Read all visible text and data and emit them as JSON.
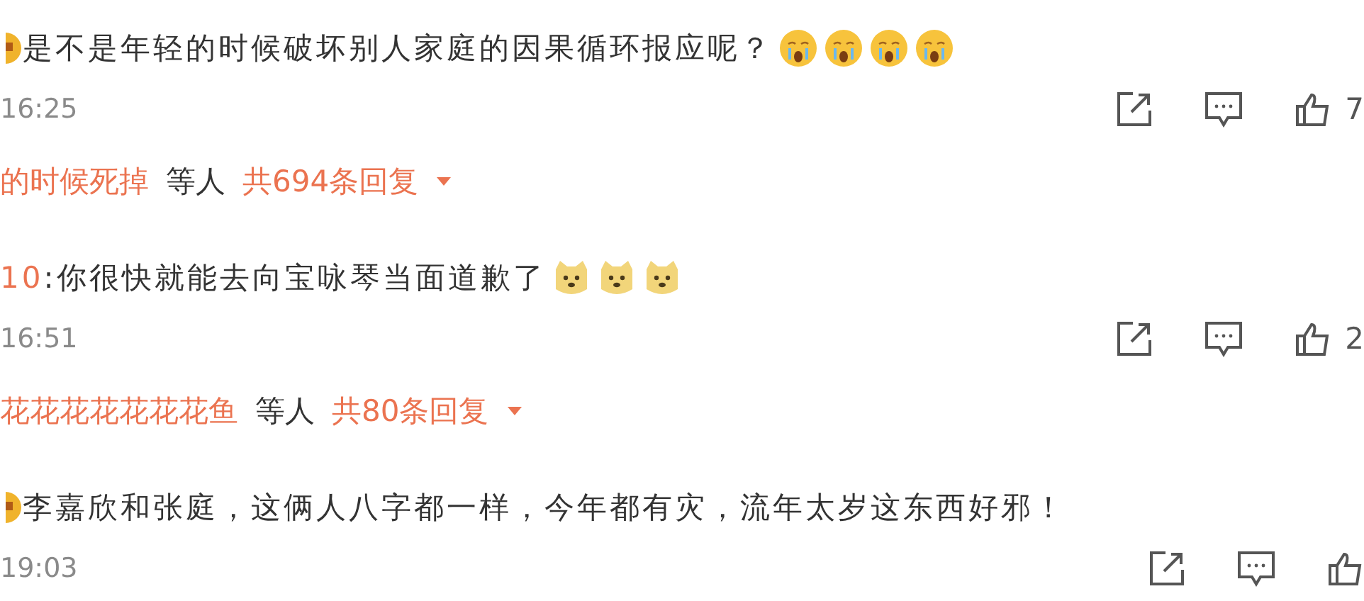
{
  "comments": [
    {
      "lead_icon": true,
      "text": "是不是年轻的时候破坏别人家庭的因果循环报应呢？",
      "emojis": [
        {
          "kind": "crying"
        },
        {
          "kind": "crying"
        },
        {
          "kind": "crying"
        },
        {
          "kind": "crying"
        }
      ],
      "time": "16:25",
      "likes": "7",
      "replies": {
        "names": "的时候死掉",
        "suffix": "等人",
        "count": "共694条回复"
      }
    },
    {
      "lead_icon": false,
      "author": "10",
      "text": ":你很快就能去向宝咏琴当面道歉了",
      "emojis": [
        {
          "kind": "doge"
        },
        {
          "kind": "doge"
        },
        {
          "kind": "doge"
        }
      ],
      "time": "16:51",
      "likes": "2",
      "replies": {
        "names": "花花花花花花花鱼",
        "suffix": "等人",
        "count": "共80条回复"
      }
    },
    {
      "lead_icon": true,
      "text": "李嘉欣和张庭，这俩人八字都一样，今年都有灾，流年太岁这东西好邪！",
      "time": "19:03"
    }
  ]
}
